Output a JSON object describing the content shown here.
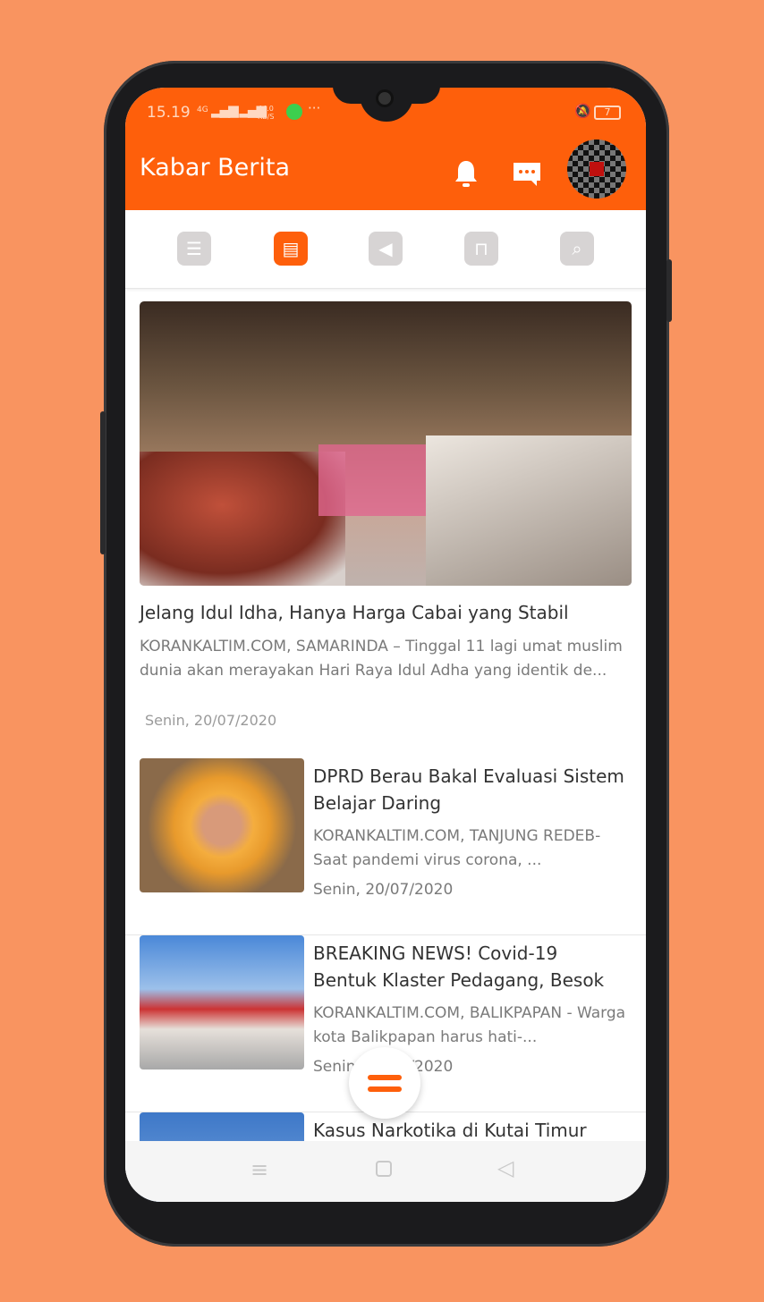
{
  "status": {
    "time": "15.19",
    "net": "4G",
    "speed": "44.0 KB/S",
    "battery": "7"
  },
  "header": {
    "title": "Kabar Berita"
  },
  "tabs": [
    {
      "icon": "list-icon"
    },
    {
      "icon": "news-icon",
      "active": true
    },
    {
      "icon": "megaphone-icon"
    },
    {
      "icon": "desk-icon"
    },
    {
      "icon": "search-icon"
    }
  ],
  "featured": {
    "title": "Jelang Idul Idha, Hanya Harga Cabai yang Stabil",
    "excerpt": "KORANKALTIM.COM, SAMARINDA – Tinggal 11 lagi umat muslim dunia akan merayakan Hari Raya Idul Adha yang identik de...",
    "date": "Senin, 20/07/2020"
  },
  "articles": [
    {
      "title": "DPRD Berau Bakal Evaluasi Sistem Belajar Daring",
      "excerpt": "KORANKALTIM.COM, TANJUNG REDEB- Saat pandemi virus corona, ...",
      "date": "Senin, 20/07/2020"
    },
    {
      "title": "BREAKING NEWS! Covid-19 Bentuk Klaster Pedagang, Besok",
      "excerpt": "KORANKALTIM.COM, BALIKPAPAN - Warga kota Balikpapan harus hati-...",
      "date": "Senin, 20/07/2020"
    },
    {
      "title": "Kasus Narkotika di Kutai Timur"
    }
  ]
}
